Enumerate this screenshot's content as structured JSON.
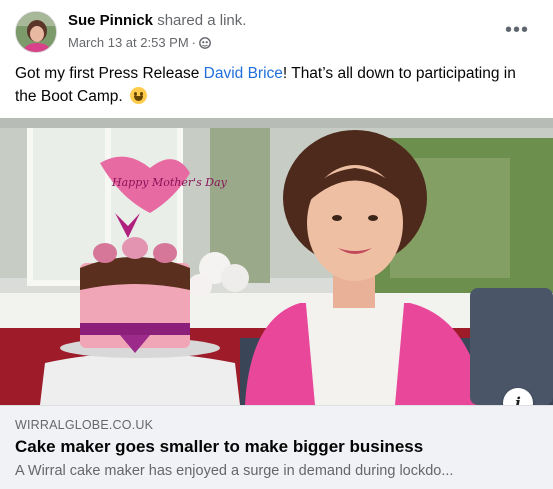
{
  "header": {
    "author_name": "Sue Pinnick",
    "action_text": "shared a link.",
    "timestamp": "March 13 at 2:53 PM",
    "separator": "·",
    "privacy_icon": "globe-icon",
    "more_icon": "more-horizontal-icon",
    "more_label": "•••"
  },
  "post": {
    "text_before": "Got my first Press Release ",
    "mention": "David Brice",
    "text_after": "!  That’s all down to participating in the Boot Camp. ",
    "emoji": "grinning-face-emoji"
  },
  "link_card": {
    "image_alt": "cake-maker-photo",
    "cake_topper_text": "Happy Mother's Day",
    "info_label": "i",
    "domain": "WIRRALGLOBE.CO.UK",
    "title": "Cake maker goes smaller to make bigger business",
    "description": "A Wirral cake maker has enjoyed a surge in demand during lockdo..."
  },
  "colors": {
    "mention": "#216fdb",
    "secondary_text": "#65676b",
    "footer_bg": "#f0f2f5",
    "shirt_pink": "#e8479a"
  }
}
